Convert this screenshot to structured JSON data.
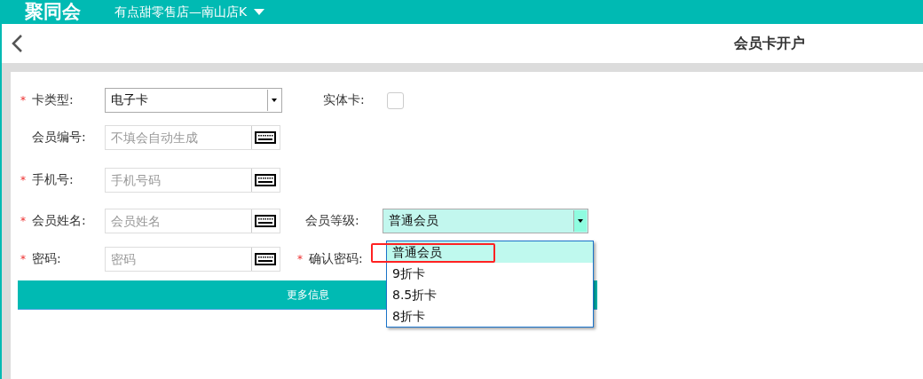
{
  "header": {
    "logo": "聚同会",
    "store": "有点甜零售店—南山店K"
  },
  "page": {
    "title": "会员卡开户"
  },
  "form": {
    "card_type": {
      "mark": "*",
      "label": "卡类型:",
      "value": "电子卡"
    },
    "physical_card": {
      "label": "实体卡:",
      "checked": false
    },
    "member_no": {
      "label": "会员编号:",
      "placeholder": "不填会自动生成"
    },
    "phone": {
      "mark": "*",
      "label": "手机号:",
      "placeholder": "手机号码"
    },
    "name": {
      "mark": "*",
      "label": "会员姓名:",
      "placeholder": "会员姓名"
    },
    "level": {
      "label": "会员等级:",
      "value": "普通会员",
      "expanded": true,
      "options": [
        {
          "label": "普通会员",
          "selected": true,
          "annotated": true
        },
        {
          "label": "9折卡",
          "selected": false,
          "annotated": false
        },
        {
          "label": "8.5折卡",
          "selected": false,
          "annotated": false
        },
        {
          "label": "8折卡",
          "selected": false,
          "annotated": false
        }
      ]
    },
    "password": {
      "mark": "*",
      "label": "密码:",
      "placeholder": "密码"
    },
    "confirm": {
      "mark": "*",
      "label": "确认密码:"
    },
    "more_button": "更多信息"
  }
}
